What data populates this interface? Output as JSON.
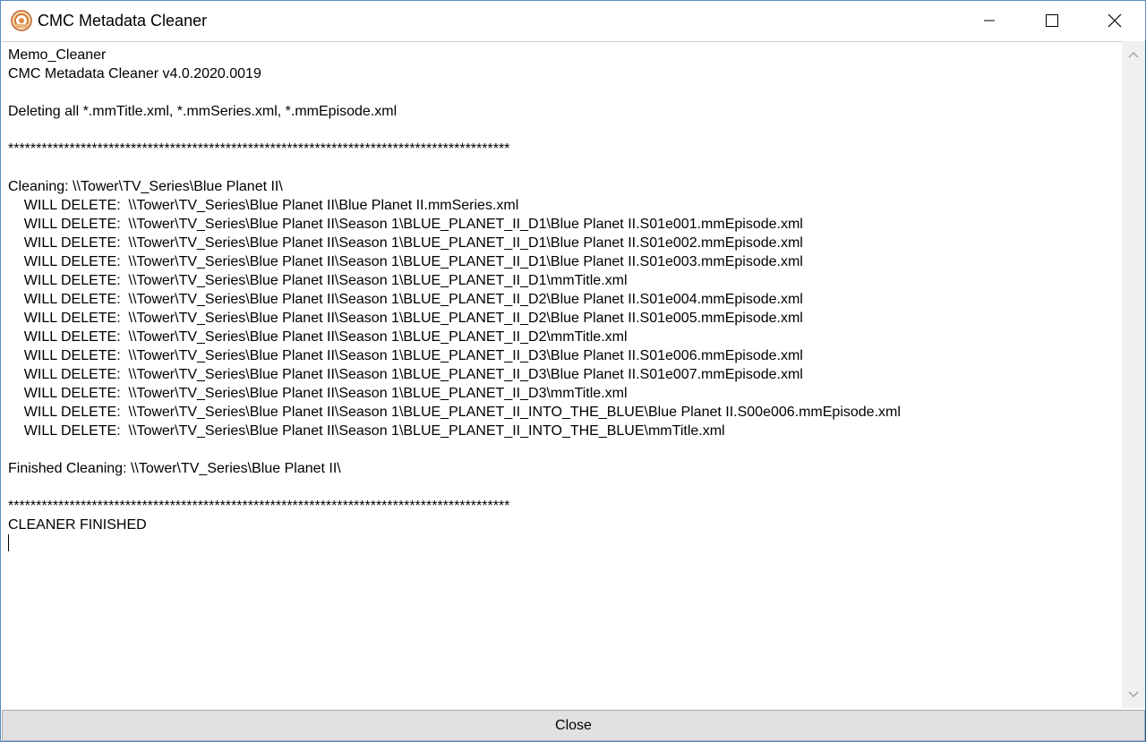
{
  "window": {
    "title": "CMC Metadata Cleaner",
    "icon": "cmc-app-icon",
    "controls": {
      "minimize": "minimize-icon",
      "maximize": "maximize-icon",
      "close": "close-icon"
    }
  },
  "memo": {
    "lines": [
      "Memo_Cleaner",
      "CMC Metadata Cleaner v4.0.2020.0019",
      "",
      "Deleting all *.mmTitle.xml, *.mmSeries.xml, *.mmEpisode.xml",
      "",
      "******************************************************************************************",
      "",
      "Cleaning: \\\\Tower\\TV_Series\\Blue Planet II\\",
      "    WILL DELETE:  \\\\Tower\\TV_Series\\Blue Planet II\\Blue Planet II.mmSeries.xml",
      "    WILL DELETE:  \\\\Tower\\TV_Series\\Blue Planet II\\Season 1\\BLUE_PLANET_II_D1\\Blue Planet II.S01e001.mmEpisode.xml",
      "    WILL DELETE:  \\\\Tower\\TV_Series\\Blue Planet II\\Season 1\\BLUE_PLANET_II_D1\\Blue Planet II.S01e002.mmEpisode.xml",
      "    WILL DELETE:  \\\\Tower\\TV_Series\\Blue Planet II\\Season 1\\BLUE_PLANET_II_D1\\Blue Planet II.S01e003.mmEpisode.xml",
      "    WILL DELETE:  \\\\Tower\\TV_Series\\Blue Planet II\\Season 1\\BLUE_PLANET_II_D1\\mmTitle.xml",
      "    WILL DELETE:  \\\\Tower\\TV_Series\\Blue Planet II\\Season 1\\BLUE_PLANET_II_D2\\Blue Planet II.S01e004.mmEpisode.xml",
      "    WILL DELETE:  \\\\Tower\\TV_Series\\Blue Planet II\\Season 1\\BLUE_PLANET_II_D2\\Blue Planet II.S01e005.mmEpisode.xml",
      "    WILL DELETE:  \\\\Tower\\TV_Series\\Blue Planet II\\Season 1\\BLUE_PLANET_II_D2\\mmTitle.xml",
      "    WILL DELETE:  \\\\Tower\\TV_Series\\Blue Planet II\\Season 1\\BLUE_PLANET_II_D3\\Blue Planet II.S01e006.mmEpisode.xml",
      "    WILL DELETE:  \\\\Tower\\TV_Series\\Blue Planet II\\Season 1\\BLUE_PLANET_II_D3\\Blue Planet II.S01e007.mmEpisode.xml",
      "    WILL DELETE:  \\\\Tower\\TV_Series\\Blue Planet II\\Season 1\\BLUE_PLANET_II_D3\\mmTitle.xml",
      "    WILL DELETE:  \\\\Tower\\TV_Series\\Blue Planet II\\Season 1\\BLUE_PLANET_II_INTO_THE_BLUE\\Blue Planet II.S00e006.mmEpisode.xml",
      "    WILL DELETE:  \\\\Tower\\TV_Series\\Blue Planet II\\Season 1\\BLUE_PLANET_II_INTO_THE_BLUE\\mmTitle.xml",
      "",
      "Finished Cleaning: \\\\Tower\\TV_Series\\Blue Planet II\\",
      "",
      "******************************************************************************************",
      "CLEANER FINISHED"
    ]
  },
  "scrollbar": {
    "up_icon": "scroll-up-arrow-icon",
    "down_icon": "scroll-down-arrow-icon"
  },
  "buttons": {
    "close_label": "Close"
  },
  "colors": {
    "window_border": "#5a8ac0",
    "button_bg": "#e1e1e1",
    "scrollbar_bg": "#f0f0f0"
  }
}
